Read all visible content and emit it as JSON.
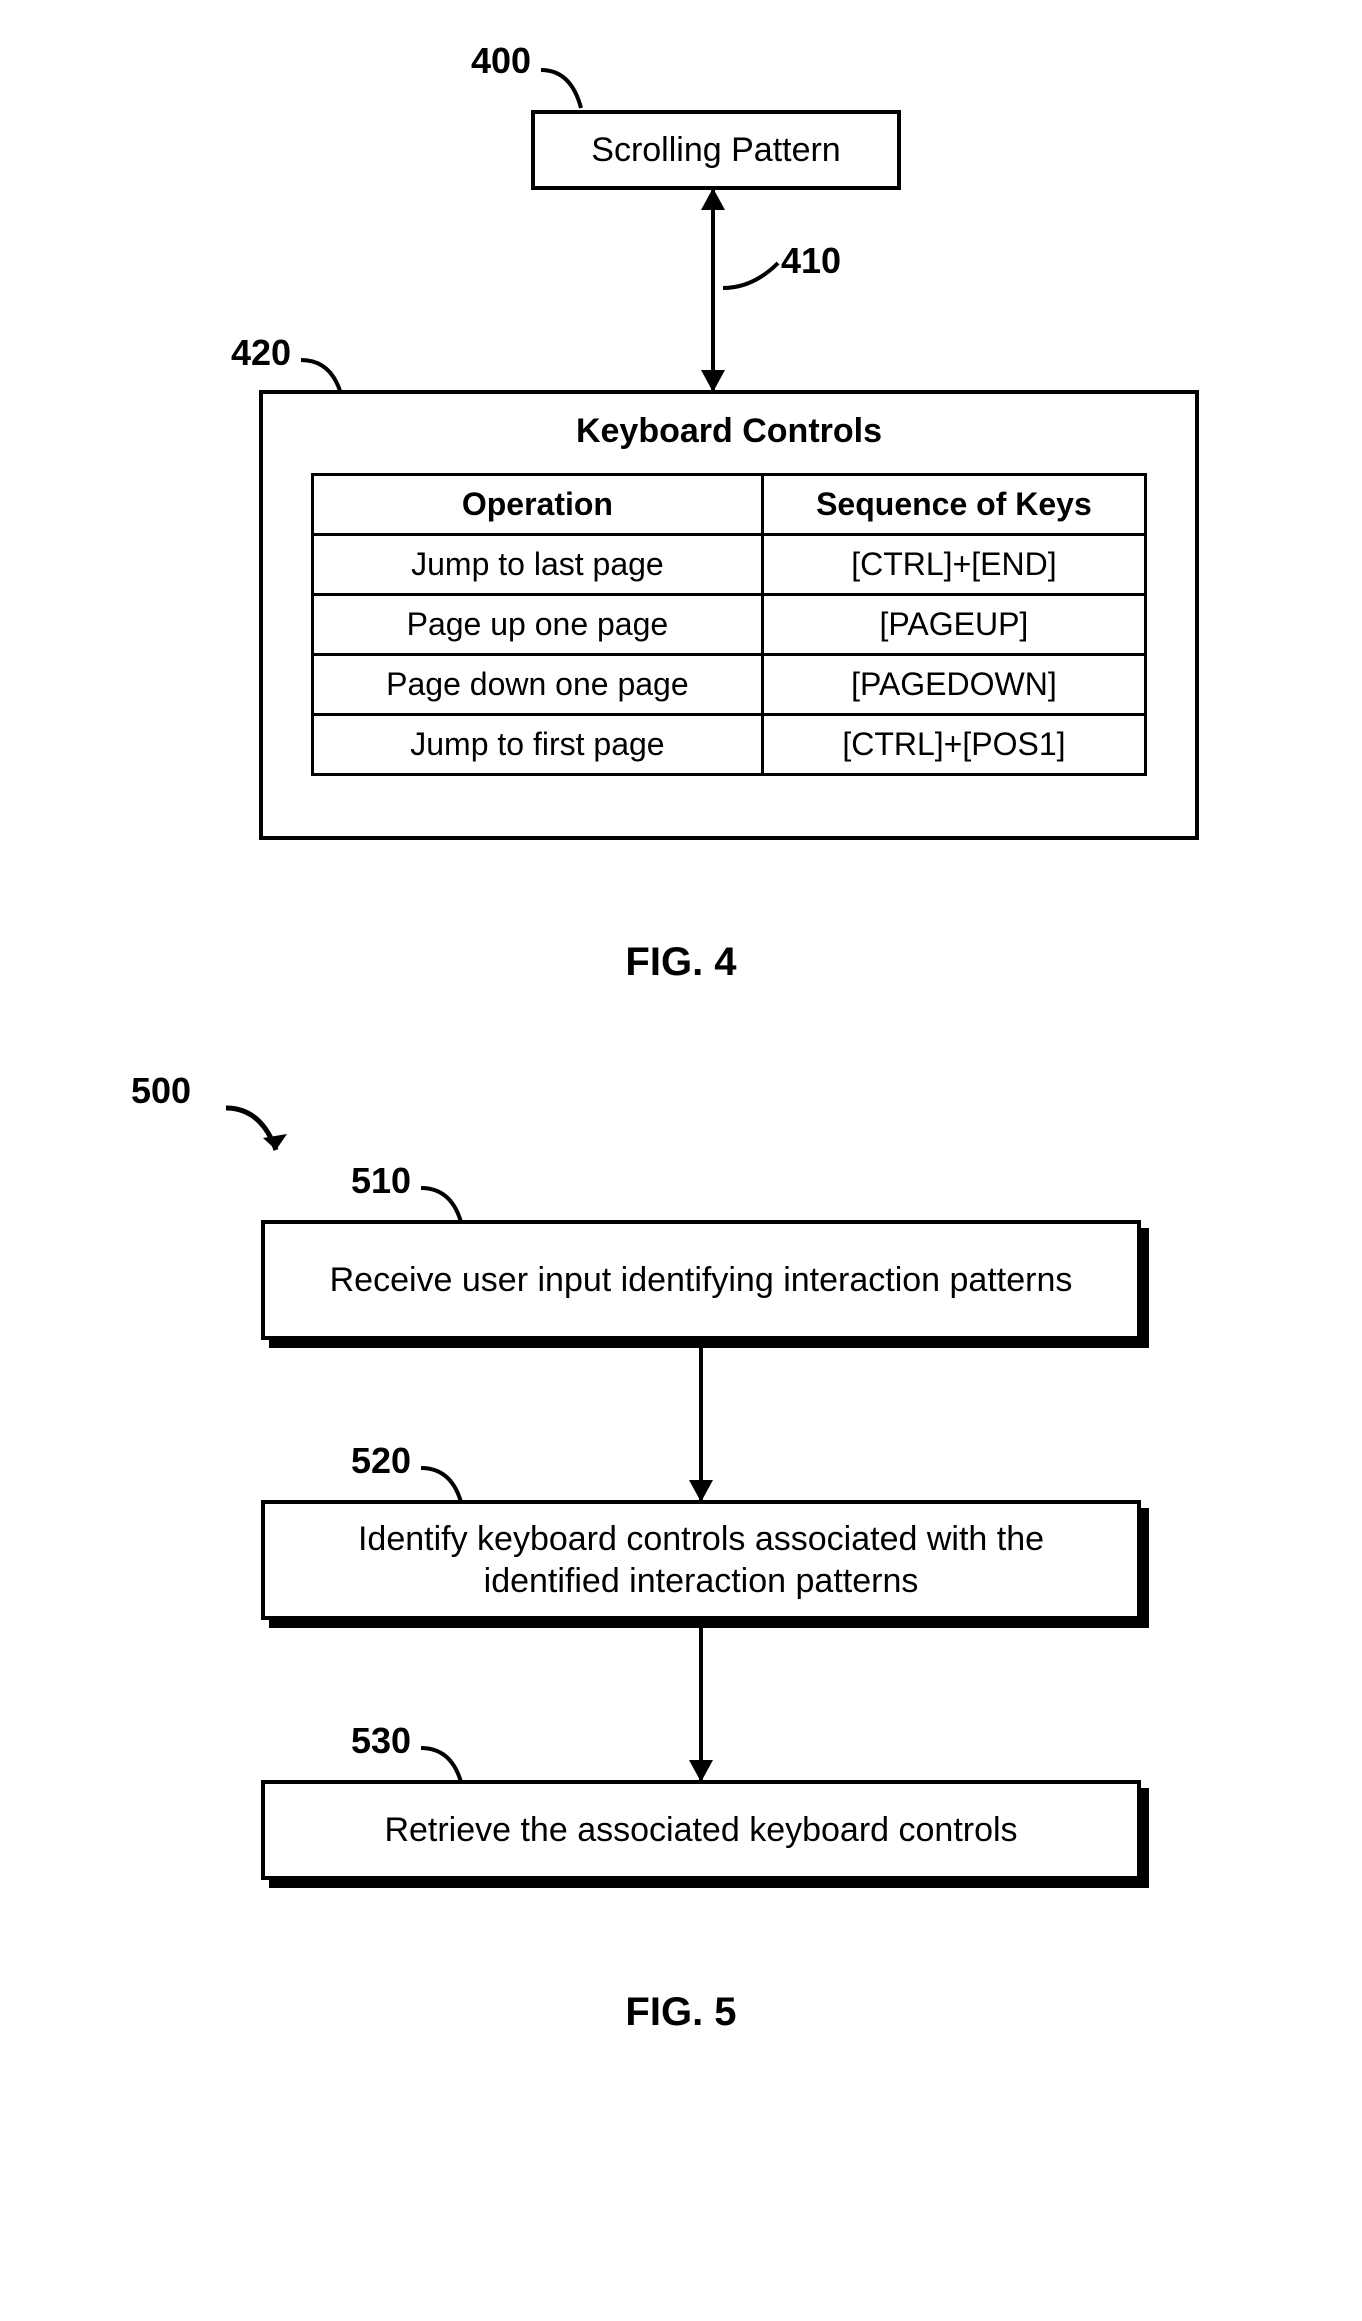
{
  "fig4": {
    "ref_400": "400",
    "ref_410": "410",
    "ref_420": "420",
    "scrolling_pattern": "Scrolling Pattern",
    "kc_title": "Keyboard Controls",
    "kc_headers": {
      "op": "Operation",
      "seq": "Sequence of Keys"
    },
    "kc_rows": [
      {
        "op": "Jump to last page",
        "seq": "[CTRL]+[END]"
      },
      {
        "op": "Page up one page",
        "seq": "[PAGEUP]"
      },
      {
        "op": "Page down one page",
        "seq": "[PAGEDOWN]"
      },
      {
        "op": "Jump to first page",
        "seq": "[CTRL]+[POS1]"
      }
    ],
    "caption": "FIG. 4"
  },
  "fig5": {
    "ref_500": "500",
    "ref_510": "510",
    "ref_520": "520",
    "ref_530": "530",
    "step_510": "Receive user input identifying interaction patterns",
    "step_520": "Identify keyboard controls associated with the identified interaction patterns",
    "step_530": "Retrieve the associated keyboard controls",
    "caption": "FIG. 5"
  }
}
